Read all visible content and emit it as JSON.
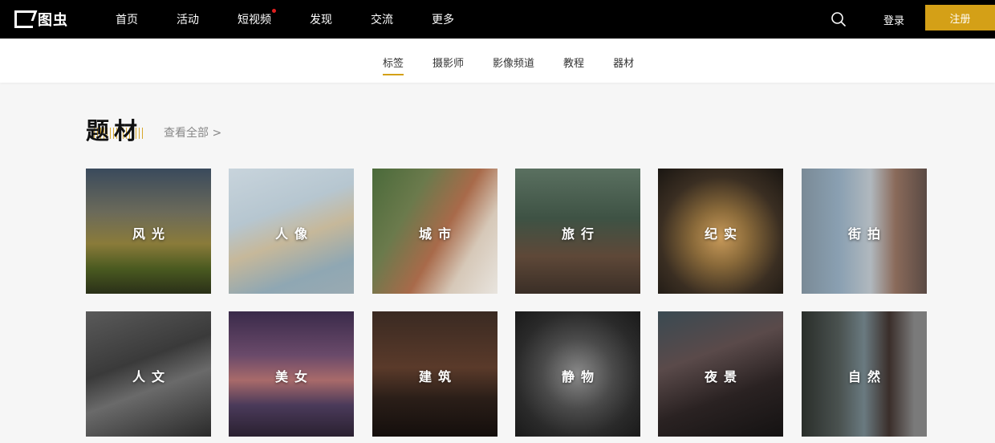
{
  "brand": {
    "logo_text": "图虫",
    "accent": "#d4a017"
  },
  "nav": {
    "items": [
      {
        "label": "首页"
      },
      {
        "label": "活动"
      },
      {
        "label": "短视频",
        "badge": true
      },
      {
        "label": "发现"
      },
      {
        "label": "交流"
      },
      {
        "label": "更多"
      }
    ],
    "login": "登录",
    "register": "注册"
  },
  "subnav": {
    "items": [
      {
        "label": "标签",
        "active": true
      },
      {
        "label": "摄影师"
      },
      {
        "label": "影像频道"
      },
      {
        "label": "教程"
      },
      {
        "label": "器材"
      }
    ]
  },
  "section": {
    "title": "题材",
    "view_all": "查看全部 >",
    "tiles": [
      {
        "label": "风光"
      },
      {
        "label": "人像"
      },
      {
        "label": "城市"
      },
      {
        "label": "旅行"
      },
      {
        "label": "纪实"
      },
      {
        "label": "街拍"
      },
      {
        "label": "人文"
      },
      {
        "label": "美女"
      },
      {
        "label": "建筑"
      },
      {
        "label": "静物"
      },
      {
        "label": "夜景"
      },
      {
        "label": "自然"
      }
    ]
  }
}
